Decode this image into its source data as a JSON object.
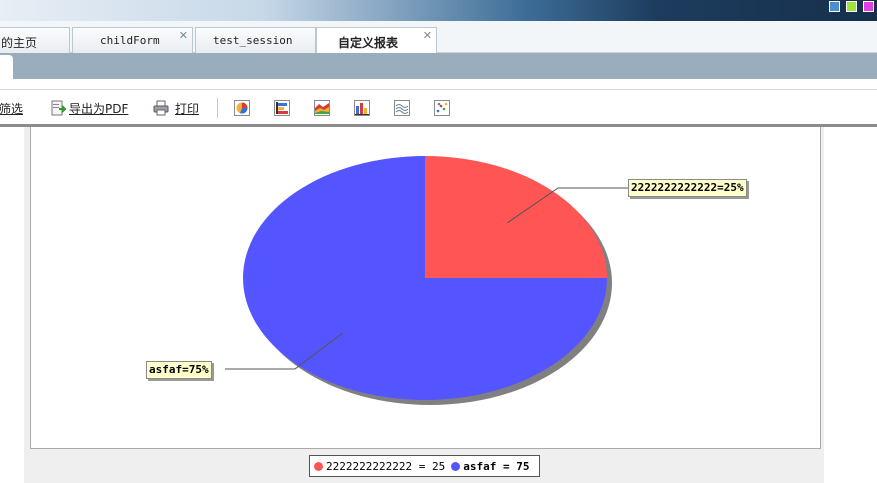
{
  "window": {
    "controls": [
      "restore-icon",
      "maximize-icon",
      "close-icon"
    ],
    "control_colors": [
      "#4a8ed4",
      "#9ee23a",
      "#e63ce6"
    ]
  },
  "tabs": [
    {
      "label": "的主页",
      "active": false,
      "closable": false
    },
    {
      "label": "childForm",
      "active": false,
      "closable": true
    },
    {
      "label": "test_session",
      "active": false,
      "closable": false
    },
    {
      "label": "自定义报表",
      "active": true,
      "closable": true
    }
  ],
  "toolbar": {
    "filter_label": "筛选",
    "export_pdf_label": "导出为PDF",
    "print_label": "打印",
    "chart_type_icons": [
      "pie-chart-icon",
      "horizontal-bar-chart-icon",
      "area-chart-icon",
      "bar-chart-icon",
      "line-chart-icon",
      "scatter-chart-icon"
    ]
  },
  "chart_data": {
    "type": "pie",
    "slices": [
      {
        "label": "2222222222222",
        "value": 25,
        "percent": "25%",
        "color": "#ff5555"
      },
      {
        "label": "asfaf",
        "value": 75,
        "percent": "75%",
        "color": "#5555ff"
      }
    ],
    "callouts": [
      "2222222222222=25%",
      "asfaf=75%"
    ],
    "legend": [
      "2222222222222 = 25",
      "asfaf = 75"
    ],
    "legend_position": "bottom"
  }
}
